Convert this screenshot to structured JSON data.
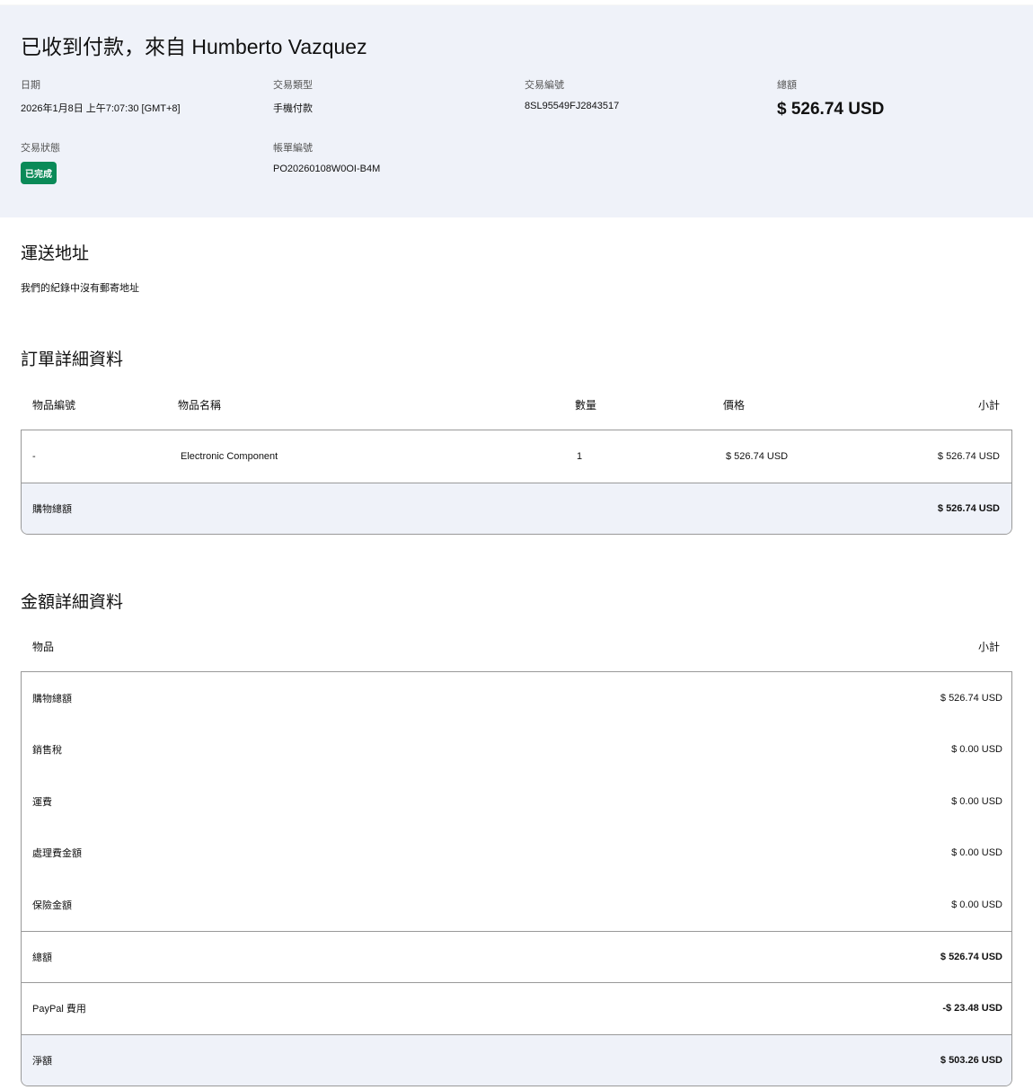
{
  "header": {
    "title": "已收到付款，來自 Humberto Vazquez",
    "date_label": "日期",
    "date": "2026年1月8日 上午7:07:30 [GMT+8]",
    "type_label": "交易類型",
    "type": "手機付款",
    "txn_label": "交易編號",
    "txn": "8SL95549FJ2843517",
    "total_label": "總額",
    "total": "$ 526.74 USD",
    "status_label": "交易狀態",
    "status": "已完成",
    "invoice_label": "帳單編號",
    "invoice": "PO20260108W0OI-B4M"
  },
  "shipping": {
    "title": "運送地址",
    "text": "我們的紀錄中沒有郵寄地址"
  },
  "order": {
    "title": "訂單詳細資料",
    "headers": [
      "物品編號",
      "物品名稱",
      "數量",
      "價格",
      "小計"
    ],
    "item": {
      "id": "-",
      "name": "Electronic Component",
      "qty": "1",
      "price": "$ 526.74 USD",
      "subtotal": "$ 526.74 USD"
    },
    "total_label": "購物總額",
    "total": "$ 526.74 USD"
  },
  "amount": {
    "title": "金額詳細資料",
    "headers": [
      "物品",
      "小計"
    ],
    "rows": [
      {
        "label": "購物總額",
        "value": "$ 526.74 USD"
      },
      {
        "label": "銷售稅",
        "value": "$ 0.00 USD"
      },
      {
        "label": "運費",
        "value": "$ 0.00 USD"
      },
      {
        "label": "處理費金額",
        "value": "$ 0.00 USD"
      },
      {
        "label": "保險金額",
        "value": "$ 0.00 USD"
      }
    ],
    "gross_label": "總額",
    "gross": "$ 526.74 USD",
    "fee_label": "PayPal 費用",
    "fee": "-$ 23.48 USD",
    "net_label": "淨額",
    "net": "$ 503.26 USD"
  },
  "colors": {
    "badge": "#0a8a58",
    "panel": "#eff2f9"
  }
}
